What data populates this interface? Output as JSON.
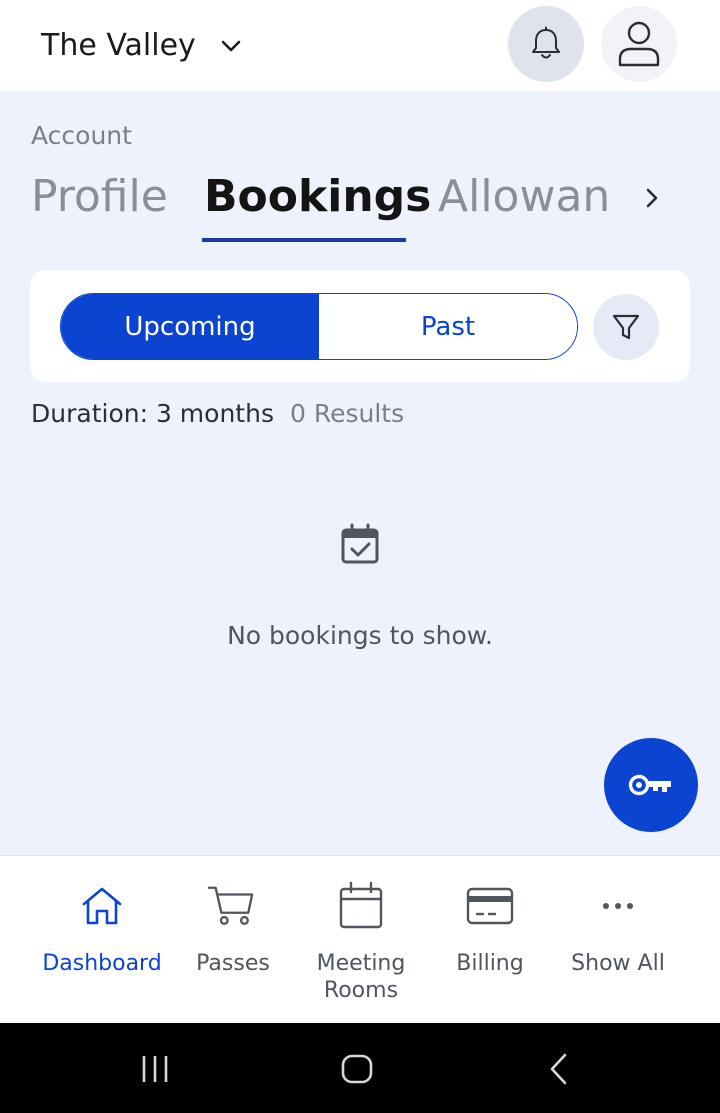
{
  "header": {
    "location_name": "The Valley"
  },
  "account": {
    "section_label": "Account",
    "tabs": [
      {
        "label": "Profile",
        "active": false
      },
      {
        "label": "Bookings",
        "active": true
      },
      {
        "label": "Allowan",
        "active": false
      }
    ]
  },
  "bookings": {
    "segments": [
      {
        "label": "Upcoming",
        "active": true
      },
      {
        "label": "Past",
        "active": false
      }
    ],
    "duration_text": "Duration: 3 months",
    "results_text": "0 Results",
    "empty_text": "No bookings to show."
  },
  "bottom_nav": {
    "items": [
      {
        "label": "Dashboard",
        "icon": "home-icon",
        "active": true
      },
      {
        "label": "Passes",
        "icon": "cart-icon",
        "active": false
      },
      {
        "label": "Meeting\nRooms",
        "icon": "calendar-icon",
        "active": false
      },
      {
        "label": "Billing",
        "icon": "credit-card-icon",
        "active": false
      },
      {
        "label": "Show All",
        "icon": "more-icon",
        "active": false
      }
    ]
  },
  "colors": {
    "accent": "#0a44d1",
    "page_background": "#eef2fd",
    "tab_underline": "#1a3aa8"
  }
}
